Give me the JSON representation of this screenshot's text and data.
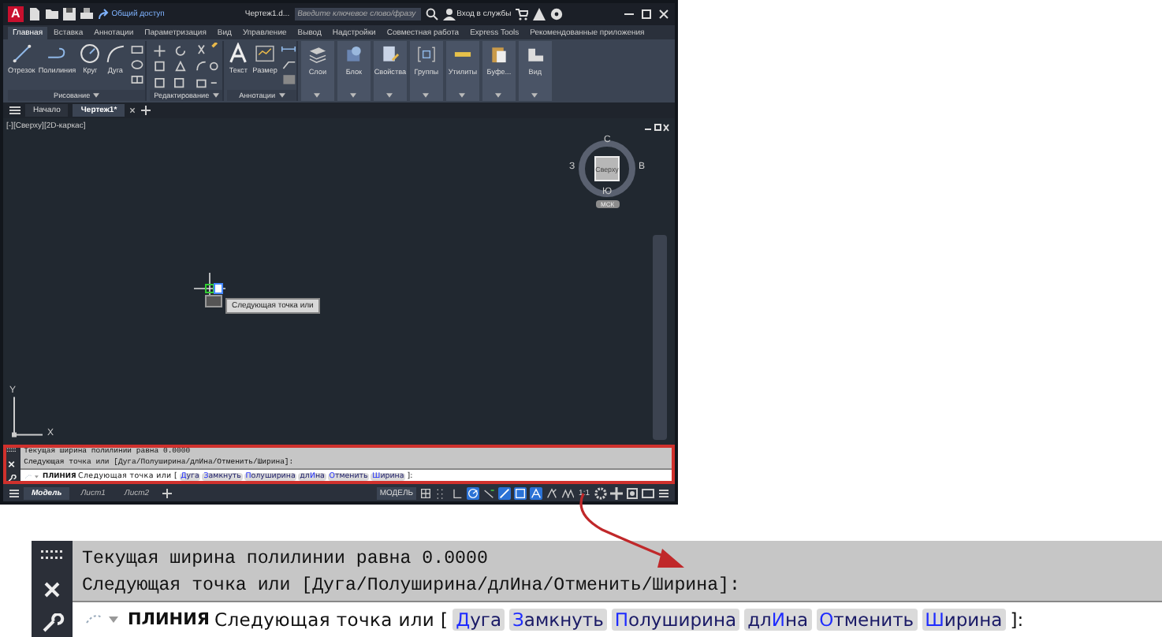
{
  "window": {
    "app_logo": "A",
    "share_label": "Общий доступ",
    "title": "Чертеж1.d...",
    "search": {
      "placeholder": "Введите ключевое слово/фразу"
    },
    "sign_in": "Вход в службы",
    "ribbon_tabs": [
      {
        "label": "Главная",
        "selected": true
      },
      {
        "label": "Вставка",
        "selected": false
      },
      {
        "label": "Аннотации",
        "selected": false
      },
      {
        "label": "Параметризация",
        "selected": false
      },
      {
        "label": "Вид",
        "selected": false
      },
      {
        "label": "Управление",
        "selected": false
      },
      {
        "label": "Вывод",
        "selected": false
      },
      {
        "label": "Надстройки",
        "selected": false
      },
      {
        "label": "Совместная работа",
        "selected": false
      },
      {
        "label": "Express Tools",
        "selected": false
      },
      {
        "label": "Рекомендованные приложения",
        "selected": false
      }
    ],
    "panels": [
      {
        "kind": "draw",
        "title": "Рисование",
        "tools": [
          {
            "label": "Отрезок",
            "kind": "line"
          },
          {
            "label": "Полилиния",
            "kind": "polyline"
          },
          {
            "label": "Круг",
            "kind": "circle"
          },
          {
            "label": "Дуга",
            "kind": "arc"
          }
        ]
      },
      {
        "kind": "edit",
        "title": "Редактирование"
      },
      {
        "kind": "annotate",
        "title": "Аннотации",
        "tools": [
          {
            "label": "Текст",
            "kind": "text"
          },
          {
            "label": "Размер",
            "kind": "dimension"
          }
        ]
      },
      {
        "kind": "big",
        "label": "Слои"
      },
      {
        "kind": "big",
        "label": "Блок"
      },
      {
        "kind": "big",
        "label": "Свойства"
      },
      {
        "kind": "big",
        "label": "Группы"
      },
      {
        "kind": "big",
        "label": "Утилиты"
      },
      {
        "kind": "big",
        "label": "Буфе..."
      },
      {
        "kind": "big",
        "label": "Вид"
      }
    ],
    "file_tabs": [
      {
        "label": "Начало",
        "selected": false
      },
      {
        "label": "Чертеж1*",
        "selected": true
      }
    ],
    "viewport_label": "[-][Сверху][2D-каркас]",
    "viewcube": {
      "north": "С",
      "west": "З",
      "east": "В",
      "south": "Ю",
      "face": "Сверху",
      "ucs": "МСК"
    },
    "tooltip": "Следующая точка или",
    "axes": {
      "y": "Y",
      "x": "X"
    },
    "command_line": {
      "history": [
        "Текущая ширина полилинии равна 0.0000",
        "Следующая точка или [Дуга/Полуширина/длИна/Отменить/Ширина]:"
      ],
      "input": {
        "command": "ПЛИНИЯ",
        "prompt": "Следующая точка или [",
        "options": [
          {
            "key": "Д",
            "after": "уга"
          },
          {
            "key": "З",
            "after": "амкнуть"
          },
          {
            "key": "П",
            "after": "олуширина"
          },
          {
            "before": "дл",
            "key": "И",
            "after": "на"
          },
          {
            "key": "О",
            "after": "тменить"
          },
          {
            "key": "Ш",
            "after": "ирина"
          }
        ],
        "end": "]:"
      }
    },
    "layout_tabs": [
      {
        "label": "Модель",
        "selected": true
      },
      {
        "label": "Лист1",
        "selected": false
      },
      {
        "label": "Лист2",
        "selected": false
      }
    ],
    "status_mode": "МОДЕЛЬ",
    "status_toggles": [
      {
        "kind": "grid",
        "on": false
      },
      {
        "kind": "snap",
        "on": false
      },
      {
        "kind": "ortho",
        "on": false
      },
      {
        "kind": "polar",
        "on": true
      },
      {
        "kind": "tracking",
        "on": false
      },
      {
        "kind": "lineweight",
        "on": true
      },
      {
        "kind": "selection",
        "on": true
      },
      {
        "kind": "annotation",
        "on": true
      },
      {
        "kind": "annovisibility",
        "on": false
      },
      {
        "kind": "autoscale",
        "on": false
      }
    ],
    "scale": "1:1"
  },
  "callout": {
    "command_line": {
      "history": [
        "Текущая ширина полилинии равна 0.0000",
        "Следующая точка или [Дуга/Полуширина/длИна/Отменить/Ширина]:"
      ],
      "input": {
        "command": "ПЛИНИЯ",
        "prompt": "Следующая точка или [",
        "options": [
          {
            "key": "Д",
            "after": "уга"
          },
          {
            "key": "З",
            "after": "амкнуть"
          },
          {
            "key": "П",
            "after": "олуширина"
          },
          {
            "before": "дл",
            "key": "И",
            "after": "на"
          },
          {
            "key": "О",
            "after": "тменить"
          },
          {
            "key": "Ш",
            "after": "ирина"
          }
        ],
        "end": "]:"
      }
    }
  }
}
